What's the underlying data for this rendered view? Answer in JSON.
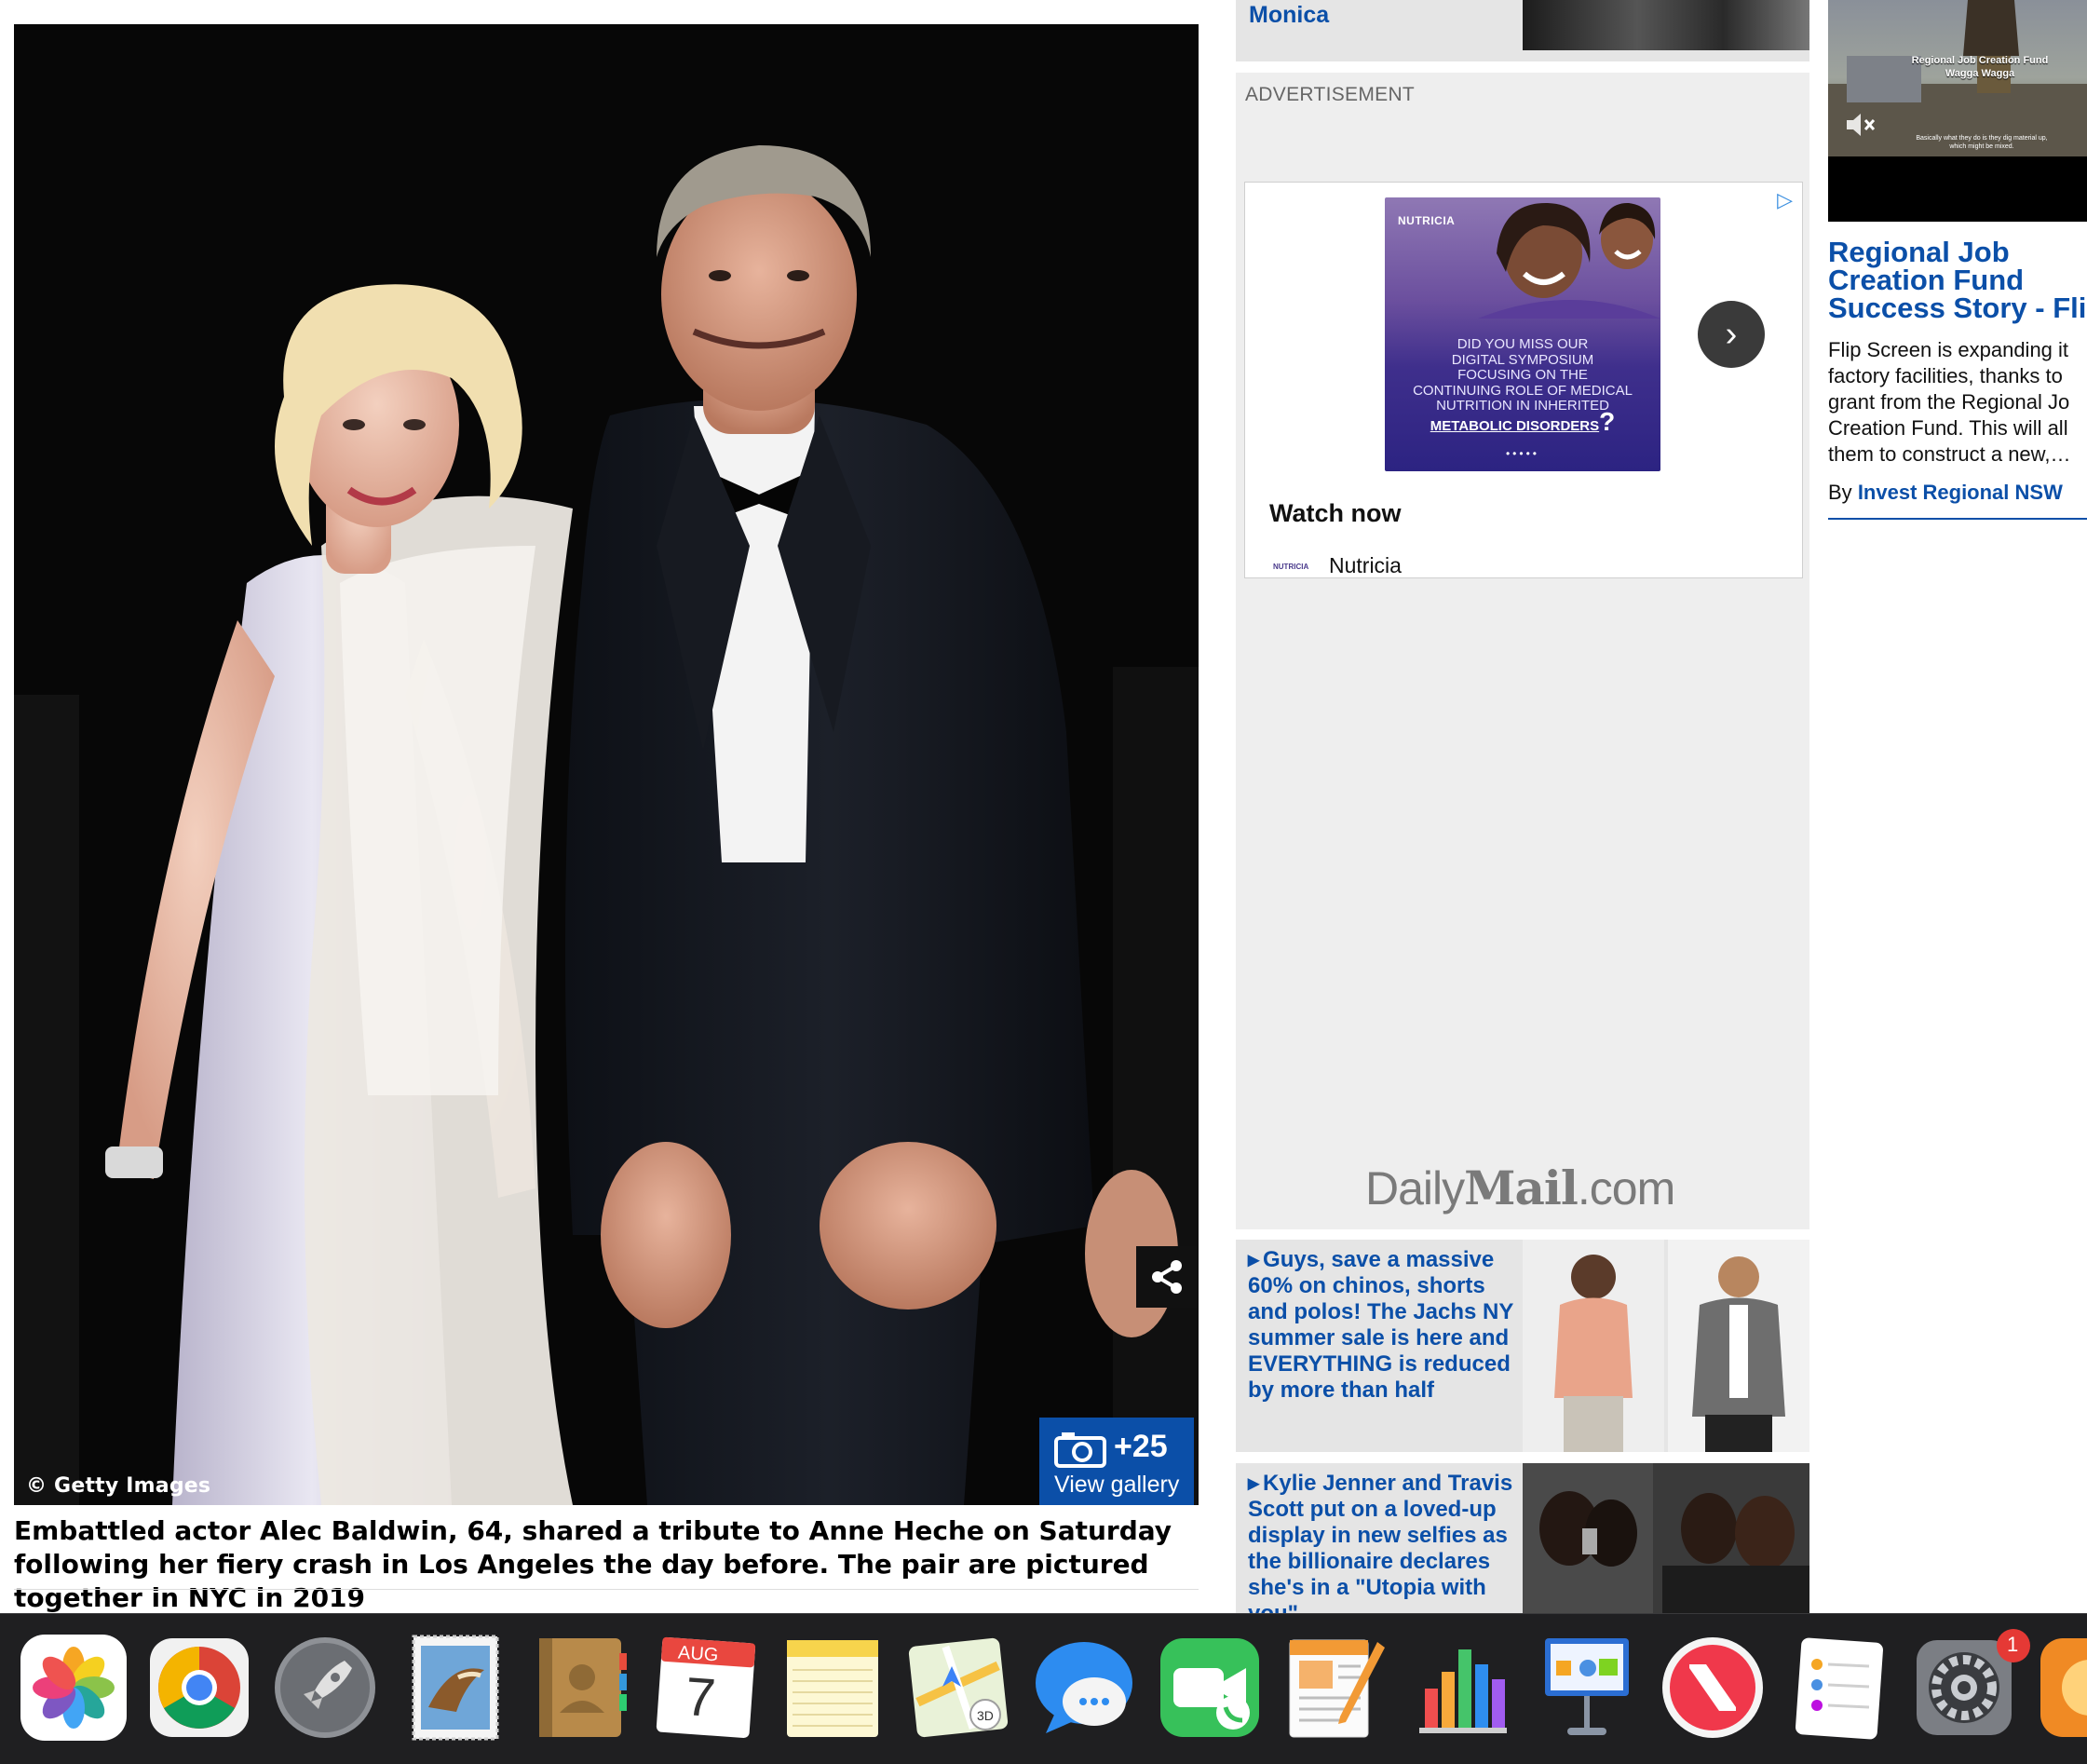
{
  "article": {
    "image_credit": "© Getty Images",
    "gallery": {
      "count": "+25",
      "label": "View gallery"
    },
    "caption": "Embattled actor Alec Baldwin, 64, shared a tribute to Anne Heche on Saturday following her fiery crash in Los Angeles the day before. The pair are pictured together in NYC in 2019"
  },
  "sidebar": {
    "top_link": "Monica",
    "advertisement_label": "ADVERTISEMENT",
    "ad": {
      "brand": "NUTRICIA",
      "headline_line1": "Did you miss our",
      "headline_line2": "digital symposium",
      "headline_line3": "focusing on the",
      "headline_line4": "continuing role of medical",
      "headline_line5": "nutrition in inherited",
      "headline_emph": "metabolic disorders",
      "headline_q": "?",
      "dots": "•••••",
      "cta": "Watch now",
      "sponsor_logo": "NUTRICIA",
      "sponsor": "Nutricia",
      "next_glyph": "›"
    },
    "logo": {
      "daily": "Daily",
      "mail": "Mail",
      "com": ".com"
    },
    "promos": [
      {
        "text": "Guys, save a massive 60% on chinos, shorts and polos! The Jachs NY summer sale is here and EVERYTHING is reduced by more than half"
      },
      {
        "text": "Kylie Jenner and Travis Scott put on a loved-up display in new selfies as the billionaire declares she's in a \"Utopia with you\""
      }
    ]
  },
  "right_rail": {
    "video_title": "Regional Job Creation Fund",
    "video_subtitle": "Wagga Wagga",
    "video_caption": "Basically what they do is they dig material up, which might be mixed.",
    "title_line1": "Regional Job",
    "title_line2": "Creation Fund",
    "title_line3": "Success Story - Flip",
    "body_line1": "Flip Screen is expanding it",
    "body_line2": "factory facilities, thanks to",
    "body_line3": "grant from the Regional Jo",
    "body_line4": "Creation Fund. This will all",
    "body_line5": "them to construct a new,…",
    "by_label": "By",
    "by_source": "Invest Regional NSW"
  },
  "dock": {
    "calendar_month": "AUG",
    "calendar_day": "7",
    "settings_badge": "1"
  },
  "colors": {
    "link_blue": "#0b4fa8",
    "gallery_blue": "#0b4fa8",
    "ad_purple": "#3f2f8c",
    "dock_bg": "#1f1f21",
    "badge_red": "#e53935"
  }
}
